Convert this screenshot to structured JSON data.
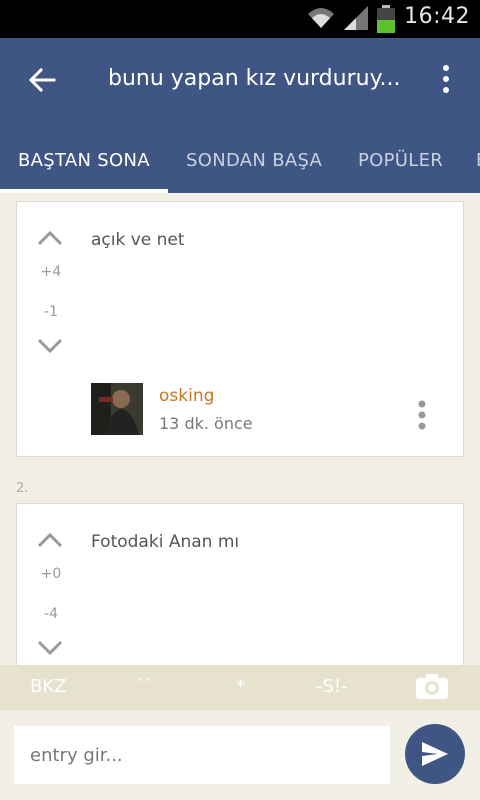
{
  "status_bar": {
    "time": "16:42",
    "icons": [
      "wifi-icon",
      "signal-icon",
      "battery-icon"
    ]
  },
  "header": {
    "title": "bunu yapan kız vurduruy...",
    "back_icon": "arrow-left-icon",
    "menu_icon": "more-vert-icon"
  },
  "tabs": [
    {
      "label": "BAŞTAN SONA",
      "active": true
    },
    {
      "label": "SONDAN BAŞA",
      "active": false
    },
    {
      "label": "POPÜLER",
      "active": false
    },
    {
      "label": "B",
      "active": false
    }
  ],
  "entries": [
    {
      "text": "açık ve net",
      "upvotes": "+4",
      "downvotes": "-1",
      "author": "osking",
      "time": "13 dk. önce"
    },
    {
      "number": "2.",
      "text": "Fotodaki Anan mı",
      "upvotes": "+0",
      "downvotes": "-4"
    }
  ],
  "toolbar": {
    "bkz": "BKZ",
    "backticks": "``",
    "star": "*",
    "spoiler": "-S!-",
    "camera_icon": "camera-icon"
  },
  "composer": {
    "placeholder": "entry gir...",
    "value": "",
    "send_icon": "send-icon"
  },
  "colors": {
    "primary": "#3f5684",
    "author": "#c9761c",
    "background": "#f2f0e6",
    "toolbar": "#e7e2cd"
  }
}
